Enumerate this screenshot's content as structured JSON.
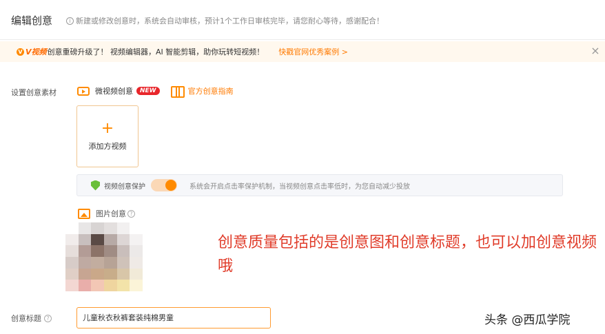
{
  "header": {
    "title": "编辑创意",
    "hint_icon": "i",
    "hint": "新建或修改创意时，系统会自动审核，预计1个工作日审核完毕，请您耐心等待，感谢配合！"
  },
  "banner": {
    "logo_mark": "V",
    "logo_text": "V视频",
    "message": "创意重磅升级了！ 视频编辑器，AI 智能剪辑，助你玩转短视频！",
    "link": "快戳官网优秀案例 >",
    "close": "×"
  },
  "form": {
    "material_label": "设置创意素材",
    "micro_video_tab": "微视频创意",
    "new_badge": "NEW",
    "guide_link": "官方创意指南",
    "upload": {
      "plus": "+",
      "label": "添加方视频"
    },
    "protection": {
      "label": "视频创意保护",
      "enabled": true,
      "description": "系统会开启点击率保护机制，当视频创意点击率低时，为您自动减少投放"
    },
    "image_creative_label": "图片创意",
    "help_icon": "?",
    "title_label": "创意标题",
    "title_value": "儿童秋衣秋裤套装纯棉男童"
  },
  "annotation": "创意质量包括的是创意图和创意标题，也可以加创意视频哦",
  "watermark": "头条 @西瓜学院",
  "colors": {
    "accent": "#ff8a00",
    "annotation": "#e03c2a",
    "badge": "#e8262b",
    "banner_bg": "#fff8ee"
  },
  "mosaic_colors": [
    "#ffffff",
    "#e8e6e6",
    "#d8d4d3",
    "#e3dfde",
    "#f2f0f0",
    "#ffffff",
    "#f1eceb",
    "#c8bfbe",
    "#5a4a45",
    "#b7aaa6",
    "#ddd6d5",
    "#f4f2f2",
    "#e6dedb",
    "#b39c96",
    "#8c7368",
    "#a08c84",
    "#c9bebb",
    "#ece9e8",
    "#d7ccc8",
    "#bfaaa2",
    "#c2ad9f",
    "#b7a396",
    "#cfc2b9",
    "#efeae6",
    "#e0cfc6",
    "#c7a592",
    "#caa889",
    "#c8ad8a",
    "#d8c6a8",
    "#f1ead8",
    "#f3d7d2",
    "#e9aeaa",
    "#f3c7b5",
    "#efd59f",
    "#f3e3a9",
    "#fbf4d8"
  ]
}
